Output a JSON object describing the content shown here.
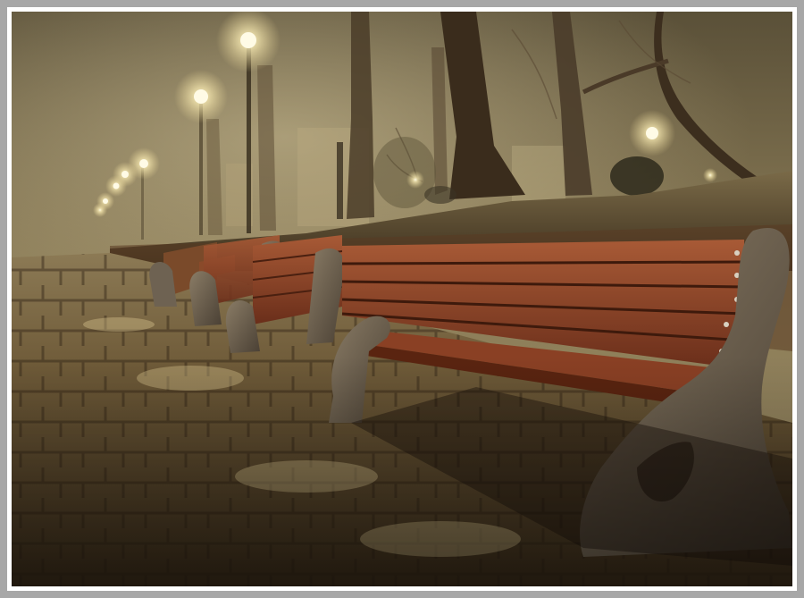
{
  "image": {
    "subject": "foggy-night-park",
    "palette": {
      "fog": "#8a7a58",
      "fog_light": "#cdbf96",
      "lamp": "#fff7d6",
      "bench_wood": "#7a3a22",
      "bench_wood_light": "#b0603a",
      "concrete": "#6e6252",
      "cobble": "#8e7449",
      "cobble_dark": "#3a2c1a",
      "grass": "#4a3a22",
      "trunk": "#3e3222",
      "border_outer": "#a7a7a7",
      "border_mat": "#ffffff"
    }
  }
}
